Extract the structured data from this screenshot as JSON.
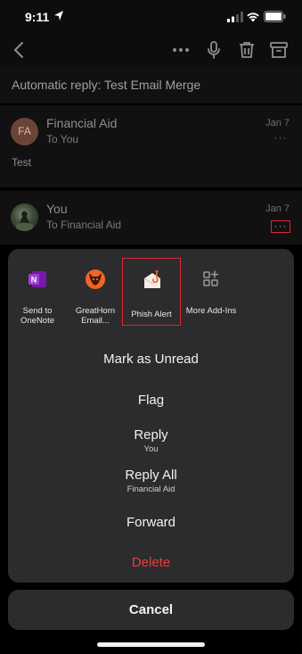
{
  "status_bar": {
    "time": "9:11"
  },
  "toolbar": {
    "icons": [
      "back-icon",
      "more-icon",
      "mic-icon",
      "trash-icon",
      "archive-icon"
    ]
  },
  "subject": "Automatic reply: Test Email Merge",
  "messages": [
    {
      "avatar_initials": "FA",
      "sender": "Financial Aid",
      "to": "To You",
      "date": "Jan 7",
      "body": "Test",
      "more": "···"
    },
    {
      "sender": "You",
      "to": "To Financial Aid",
      "date": "Jan 7",
      "more": "···"
    }
  ],
  "addins": [
    {
      "label": "Send to OneNote",
      "icon": "onenote-icon"
    },
    {
      "label": "GreatHorn Email...",
      "icon": "greathorn-icon"
    },
    {
      "label": "Phish Alert",
      "icon": "phish-alert-icon",
      "selected": true
    },
    {
      "label": "More Add-Ins",
      "icon": "add-ins-icon"
    }
  ],
  "actions": {
    "mark_unread": "Mark as Unread",
    "flag": "Flag",
    "reply": "Reply",
    "reply_sub": "You",
    "reply_all": "Reply All",
    "reply_all_sub": "Financial Aid",
    "forward": "Forward",
    "delete": "Delete"
  },
  "cancel": "Cancel",
  "colors": {
    "accent_red": "#e0262b",
    "delete_red": "#e0403b",
    "sheet_bg": "#2c2c2e"
  }
}
